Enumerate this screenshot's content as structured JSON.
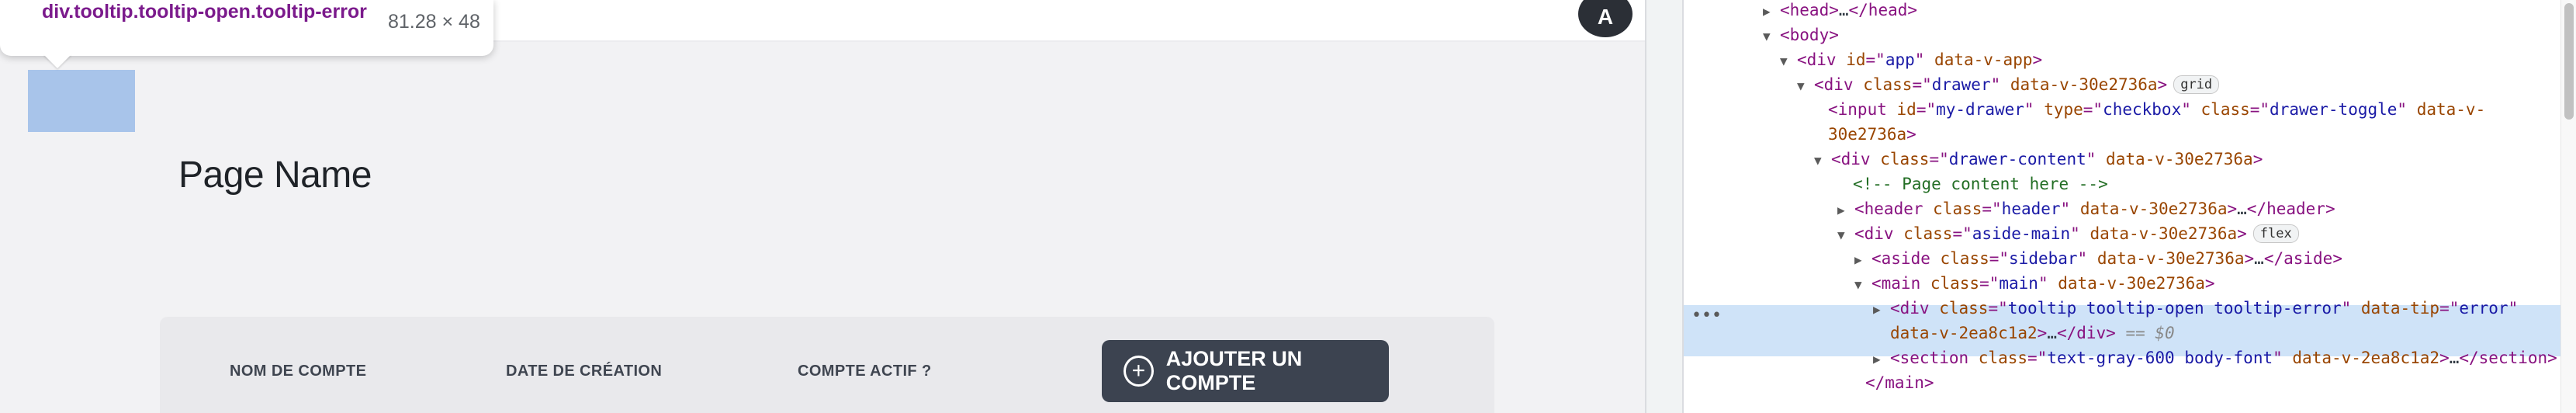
{
  "inspect": {
    "selector": "div.tooltip.tooltip-open.tooltip-error",
    "dimensions": "81.28 × 48"
  },
  "avatar": {
    "initial": "A"
  },
  "page": {
    "title": "Page Name",
    "columns": [
      "NOM DE COMPTE",
      "DATE DE CRÉATION",
      "COMPTE ACTIF ?"
    ],
    "add_button": "AJOUTER UN COMPTE"
  },
  "devtools": {
    "lines": [
      {
        "tri": "▶",
        "parts": [
          [
            "tg",
            "<head>"
          ],
          [
            "tx",
            "…"
          ],
          [
            "tg",
            "</head>"
          ]
        ]
      },
      {
        "tri": "▼",
        "parts": [
          [
            "tg",
            "<body>"
          ]
        ]
      },
      {
        "tri": "▼",
        "parts": [
          [
            "tg",
            "<div "
          ],
          [
            "an",
            "id"
          ],
          [
            "tg",
            "=\""
          ],
          [
            "av",
            "app"
          ],
          [
            "tg",
            "\" "
          ],
          [
            "an",
            "data-v-app"
          ],
          [
            "tg",
            ">"
          ]
        ]
      },
      {
        "tri": "▼",
        "parts": [
          [
            "tg",
            "<div "
          ],
          [
            "an",
            "class"
          ],
          [
            "tg",
            "=\""
          ],
          [
            "av",
            "drawer"
          ],
          [
            "tg",
            "\" "
          ],
          [
            "an",
            "data-v-30e2736a"
          ],
          [
            "tg",
            ">"
          ]
        ],
        "badge": "grid"
      },
      {
        "tri": "",
        "parts": [
          [
            "tg",
            "<input "
          ],
          [
            "an",
            "id"
          ],
          [
            "tg",
            "=\""
          ],
          [
            "av",
            "my-drawer"
          ],
          [
            "tg",
            "\" "
          ],
          [
            "an",
            "type"
          ],
          [
            "tg",
            "=\""
          ],
          [
            "av",
            "checkbox"
          ],
          [
            "tg",
            "\" "
          ],
          [
            "an",
            "class"
          ],
          [
            "tg",
            "=\""
          ],
          [
            "av",
            "drawer-toggle"
          ],
          [
            "tg",
            "\" "
          ],
          [
            "an",
            "data-v-"
          ]
        ]
      },
      {
        "tri": "",
        "parts": [
          [
            "an",
            "30e2736a"
          ],
          [
            "tg",
            ">"
          ]
        ]
      },
      {
        "tri": "▼",
        "parts": [
          [
            "tg",
            "<div "
          ],
          [
            "an",
            "class"
          ],
          [
            "tg",
            "=\""
          ],
          [
            "av",
            "drawer-content"
          ],
          [
            "tg",
            "\" "
          ],
          [
            "an",
            "data-v-30e2736a"
          ],
          [
            "tg",
            ">"
          ]
        ]
      },
      {
        "tri": "",
        "parts": [
          [
            "cm",
            "<!-- Page content here -->"
          ]
        ]
      },
      {
        "tri": "▶",
        "parts": [
          [
            "tg",
            "<header "
          ],
          [
            "an",
            "class"
          ],
          [
            "tg",
            "=\""
          ],
          [
            "av",
            "header"
          ],
          [
            "tg",
            "\" "
          ],
          [
            "an",
            "data-v-30e2736a"
          ],
          [
            "tg",
            ">"
          ],
          [
            "tx",
            "…"
          ],
          [
            "tg",
            "</header>"
          ]
        ]
      },
      {
        "tri": "▼",
        "parts": [
          [
            "tg",
            "<div "
          ],
          [
            "an",
            "class"
          ],
          [
            "tg",
            "=\""
          ],
          [
            "av",
            "aside-main"
          ],
          [
            "tg",
            "\" "
          ],
          [
            "an",
            "data-v-30e2736a"
          ],
          [
            "tg",
            ">"
          ]
        ],
        "badge": "flex"
      },
      {
        "tri": "▶",
        "parts": [
          [
            "tg",
            "<aside "
          ],
          [
            "an",
            "class"
          ],
          [
            "tg",
            "=\""
          ],
          [
            "av",
            "sidebar"
          ],
          [
            "tg",
            "\" "
          ],
          [
            "an",
            "data-v-30e2736a"
          ],
          [
            "tg",
            ">"
          ],
          [
            "tx",
            "…"
          ],
          [
            "tg",
            "</aside>"
          ]
        ]
      },
      {
        "tri": "▼",
        "parts": [
          [
            "tg",
            "<main "
          ],
          [
            "an",
            "class"
          ],
          [
            "tg",
            "=\""
          ],
          [
            "av",
            "main"
          ],
          [
            "tg",
            "\" "
          ],
          [
            "an",
            "data-v-30e2736a"
          ],
          [
            "tg",
            ">"
          ]
        ]
      },
      {
        "tri": "▶",
        "parts": [
          [
            "tg",
            "<div "
          ],
          [
            "an",
            "class"
          ],
          [
            "tg",
            "=\""
          ],
          [
            "av",
            "tooltip tooltip-open tooltip-error"
          ],
          [
            "tg",
            "\" "
          ],
          [
            "an",
            "data-tip"
          ],
          [
            "tg",
            "=\""
          ],
          [
            "av",
            "error"
          ],
          [
            "tg",
            "\""
          ]
        ]
      },
      {
        "tri": "",
        "parts": [
          [
            "an",
            "data-v-2ea8c1a2"
          ],
          [
            "tg",
            ">"
          ],
          [
            "tx",
            "…"
          ],
          [
            "tg",
            "</div>"
          ],
          [
            "dl",
            " == $0"
          ]
        ]
      },
      {
        "tri": "▶",
        "parts": [
          [
            "tg",
            "<section "
          ],
          [
            "an",
            "class"
          ],
          [
            "tg",
            "=\""
          ],
          [
            "av",
            "text-gray-600 body-font"
          ],
          [
            "tg",
            "\" "
          ],
          [
            "an",
            "data-v-2ea8c1a2"
          ],
          [
            "tg",
            ">"
          ],
          [
            "tx",
            "…"
          ],
          [
            "tg",
            "</section>"
          ]
        ]
      },
      {
        "tri": "",
        "parts": [
          [
            "tg",
            "</main>"
          ]
        ]
      }
    ],
    "colors": {
      "selected": "#cfe3f8",
      "tag": "#881280",
      "attr_name": "#994500",
      "attr_value": "#1a1aa6"
    }
  }
}
